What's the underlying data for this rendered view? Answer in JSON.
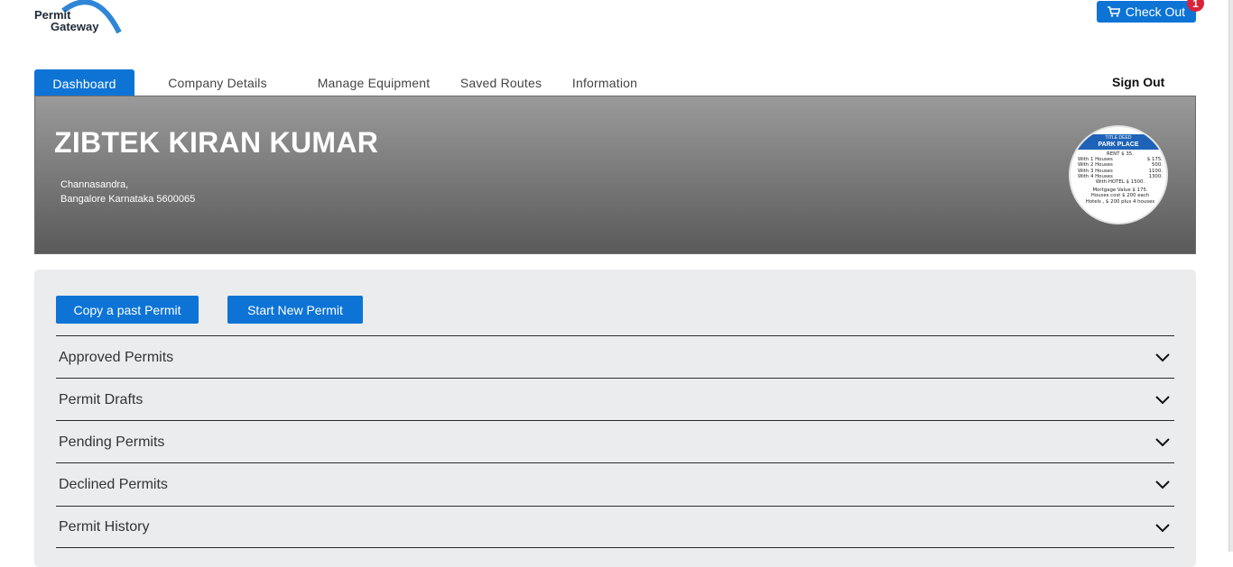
{
  "brand": {
    "line1": "Permit",
    "line2": "Gateway"
  },
  "header": {
    "checkout_label": "Check Out",
    "cart_count": "1",
    "accent": "#0d74d6",
    "badge_color": "#d9233a"
  },
  "nav": {
    "tabs": [
      {
        "label": "Dashboard",
        "active": true
      },
      {
        "label": "Company Details"
      },
      {
        "label": "Manage Equipment"
      },
      {
        "label": "Saved Routes"
      },
      {
        "label": "Information"
      }
    ],
    "signout_label": "Sign Out"
  },
  "company": {
    "name": "ZIBTEK KIRAN KUMAR",
    "address_line1": "Channasandra,",
    "address_line2": "Bangalore Karnataka 5600065"
  },
  "avatar_card": {
    "top_line": "TITLE DEED",
    "title": "PARK PLACE",
    "rent": "RENT $ 35.",
    "rows": [
      {
        "label": "With 1 Houses",
        "value": "$ 175."
      },
      {
        "label": "With 2 Houses",
        "value": "500."
      },
      {
        "label": "With 3 Houses",
        "value": "1100."
      },
      {
        "label": "With 4 Houses",
        "value": "1300."
      }
    ],
    "hotel": "With HOTEL $ 1500.",
    "mortgage": "Mortgage Value $ 175.",
    "houses_cost": "Houses cost $ 200 each",
    "hotels": "Hotels , $ 200 plus 4 houses"
  },
  "actions": {
    "copy_label": "Copy a past Permit",
    "new_label": "Start New Permit"
  },
  "sections": [
    {
      "label": "Approved Permits"
    },
    {
      "label": "Permit Drafts"
    },
    {
      "label": "Pending Permits"
    },
    {
      "label": "Declined Permits"
    },
    {
      "label": "Permit History"
    }
  ]
}
